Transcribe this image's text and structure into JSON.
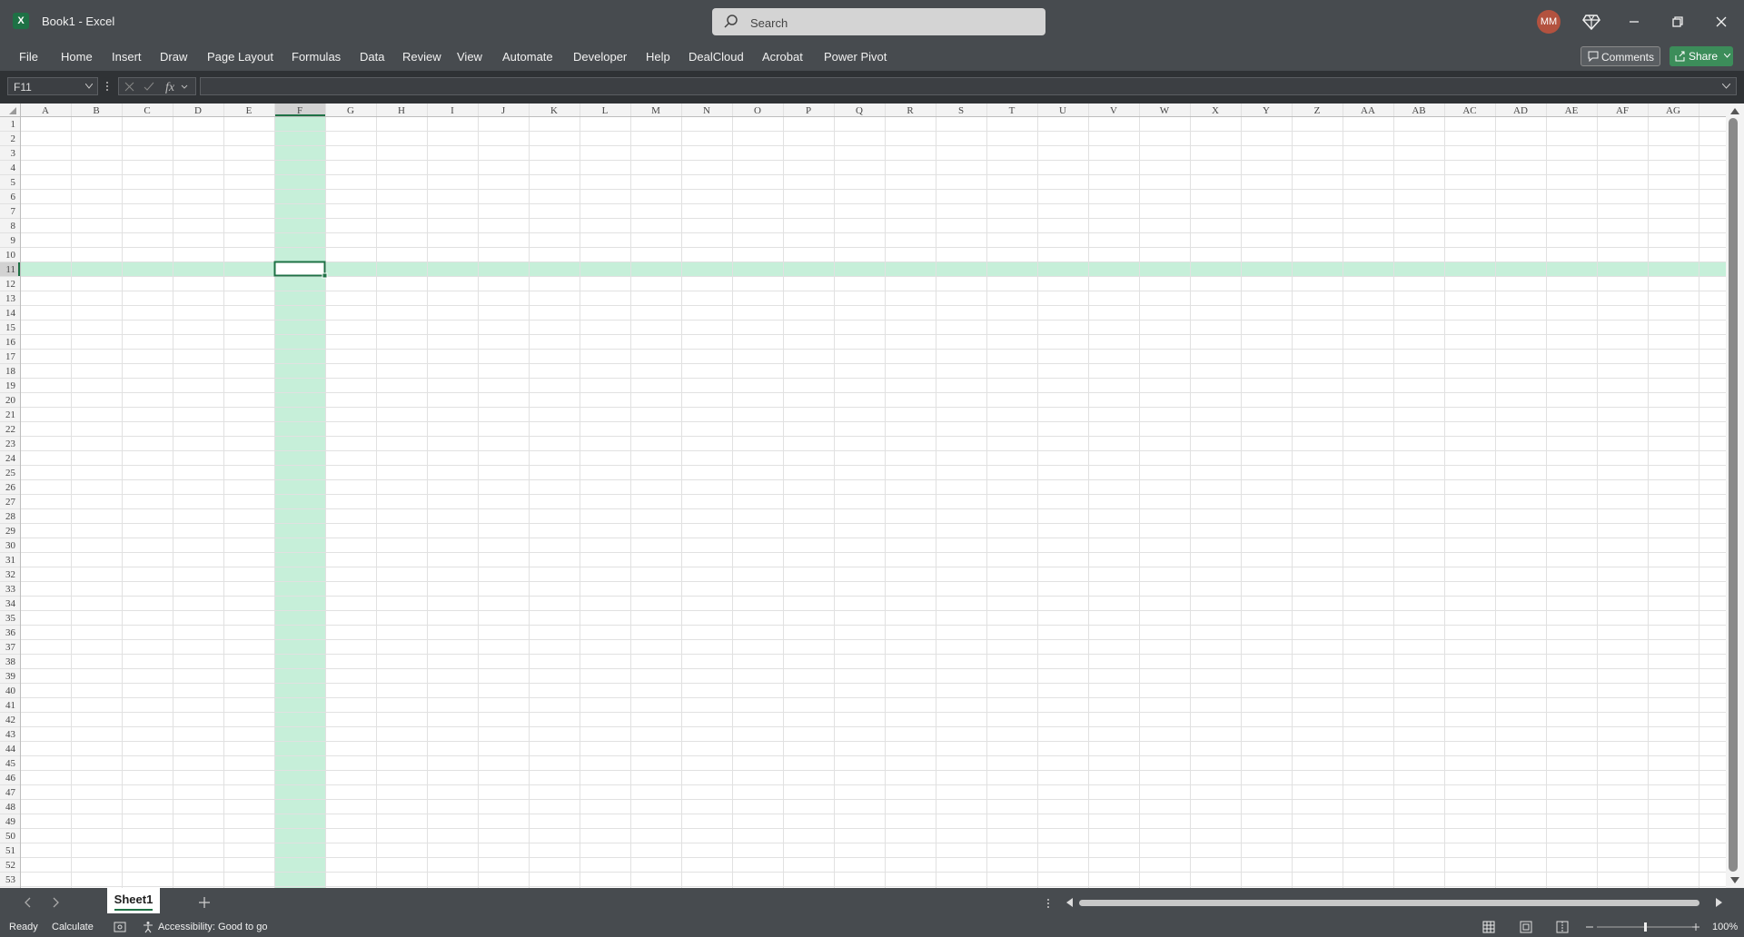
{
  "app": {
    "title": "Book1  -  Excel",
    "logo_letter": "X",
    "search_placeholder": "Search",
    "user_initials": "MM"
  },
  "menu": [
    "File",
    "Home",
    "Insert",
    "Draw",
    "Page Layout",
    "Formulas",
    "Data",
    "Review",
    "View",
    "Automate",
    "Developer",
    "Help",
    "DealCloud",
    "Acrobat",
    "Power Pivot"
  ],
  "toolbar": {
    "comments_label": "Comments",
    "share_label": "Share"
  },
  "formula_bar": {
    "name_box": "F11",
    "formula": ""
  },
  "grid": {
    "columns": [
      "A",
      "B",
      "C",
      "D",
      "E",
      "F",
      "G",
      "H",
      "I",
      "J",
      "K",
      "L",
      "M",
      "N",
      "O",
      "P",
      "Q",
      "R",
      "S",
      "T",
      "U",
      "V",
      "W",
      "X",
      "Y",
      "Z",
      "AA",
      "AB",
      "AC",
      "AD",
      "AE",
      "AF",
      "AG",
      "A"
    ],
    "row_count": 53,
    "selected_column": "F",
    "selected_row": 11,
    "accent_color": "#1e7145",
    "highlight_color": "#c6efd9"
  },
  "sheets": {
    "tabs": [
      "Sheet1"
    ],
    "active": "Sheet1"
  },
  "status": {
    "ready": "Ready",
    "calculate": "Calculate",
    "accessibility": "Accessibility: Good to go",
    "zoom": "100%"
  }
}
